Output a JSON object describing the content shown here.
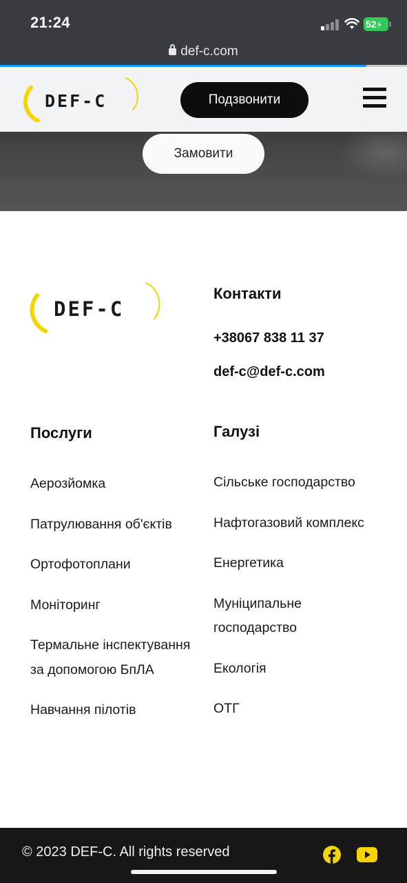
{
  "status_bar": {
    "time": "21:24",
    "battery": "52"
  },
  "browser": {
    "url": "def-c.com"
  },
  "header": {
    "logo_text": "DEF-C",
    "call_label": "Подзвонити"
  },
  "hero": {
    "order_label": "Замовити"
  },
  "footer": {
    "logo_text": "DEF-C",
    "contacts": {
      "heading": "Контакти",
      "phone": "+38067 838 11 37",
      "email": "def-c@def-c.com"
    },
    "services": {
      "heading": "Послуги",
      "items": [
        "Аерозйомка",
        "Патрулювання об'єктів",
        "Ортофотоплани",
        "Моніторинг",
        "Термальне інспектування за допомогою БпЛА",
        "Навчання пілотів"
      ]
    },
    "industries": {
      "heading": "Галузі",
      "items": [
        "Сільське господарство",
        "Нафтогазовий комплекс",
        "Енергетика",
        "Муніципальне господарство",
        "Екологія",
        "ОТГ"
      ]
    },
    "copyright": "© 2023 DEF-C. All rights reserved"
  },
  "colors": {
    "brand_yellow": "#f5d400",
    "dark": "#0d0d0d",
    "status_green": "#34c759"
  },
  "icons": {
    "facebook": "facebook-icon",
    "youtube": "youtube-icon",
    "menu": "hamburger-menu-icon",
    "lock": "lock-icon"
  }
}
